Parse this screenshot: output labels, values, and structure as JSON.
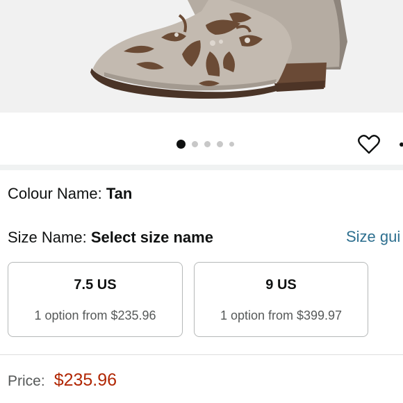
{
  "product_image": {
    "alt": "Tan suede ankle boot with brown embroidered scroll design"
  },
  "carousel": {
    "total": 5,
    "active_index": 0
  },
  "icons": {
    "wishlist": "heart-icon",
    "share": "share-icon"
  },
  "colour": {
    "label": "Colour Name:",
    "value": "Tan"
  },
  "size": {
    "label": "Size Name:",
    "value": "Select size name",
    "guide_link": "Size gui"
  },
  "size_options": [
    {
      "name": "7.5 US",
      "detail": "1 option from $235.96"
    },
    {
      "name": "9 US",
      "detail": "1 option from $399.97"
    }
  ],
  "price": {
    "label": "Price:",
    "value": "$235.96"
  },
  "colors": {
    "price": "#b12704",
    "link": "#2d6f8f",
    "text": "#0f1111",
    "muted": "#565959"
  }
}
